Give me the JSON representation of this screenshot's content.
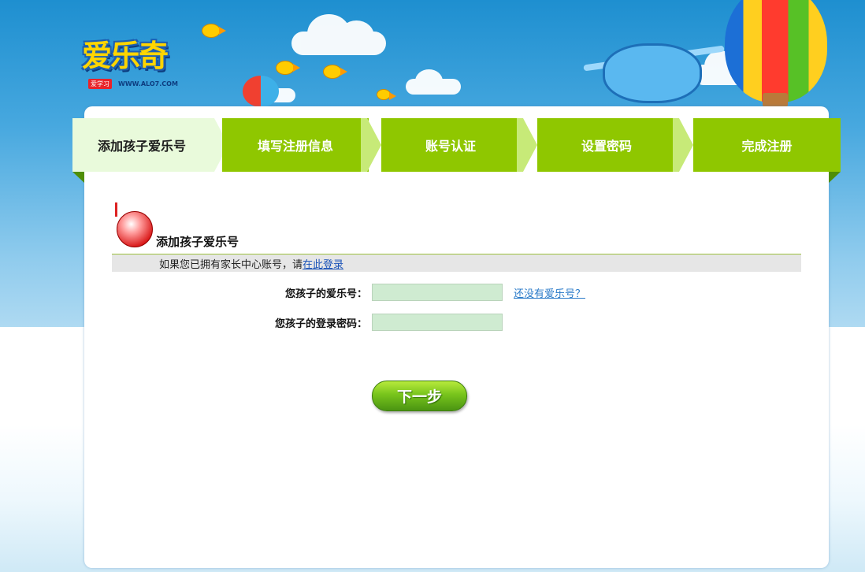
{
  "brand": {
    "logo_text": "爱乐奇",
    "badge": "爱学习",
    "url": "WWW.ALO7.COM"
  },
  "steps": [
    {
      "label": "添加孩子爱乐号",
      "active": true
    },
    {
      "label": "填写注册信息",
      "active": false
    },
    {
      "label": "账号认证",
      "active": false
    },
    {
      "label": "设置密码",
      "active": false
    },
    {
      "label": "完成注册",
      "active": false
    }
  ],
  "section": {
    "title": "添加孩子爱乐号",
    "notice_prefix": "如果您已拥有家长中心账号，请",
    "notice_link": "在此登录"
  },
  "form": {
    "child_id_label": "您孩子的爱乐号：",
    "child_id_value": "",
    "child_password_label": "您孩子的登录密码：",
    "child_password_value": "",
    "no_id_link": "还没有爱乐号？"
  },
  "actions": {
    "next_label": "下一步"
  },
  "colors": {
    "step_bar": "#8fc700",
    "step_active_bg": "#e9fadb",
    "input_bg": "#cfebd1",
    "link": "#1a53b8"
  }
}
